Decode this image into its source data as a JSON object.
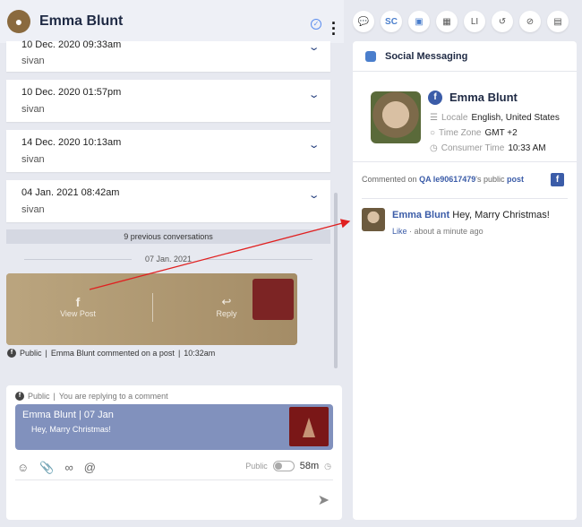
{
  "header": {
    "name": "Emma Blunt"
  },
  "conversations": [
    {
      "date": "10 Dec. 2020 09:33am",
      "user": "sivan"
    },
    {
      "date": "10 Dec. 2020 01:57pm",
      "user": "sivan"
    },
    {
      "date": "14 Dec. 2020 10:13am",
      "user": "sivan"
    },
    {
      "date": "04 Jan. 2021 08:42am",
      "user": "sivan"
    }
  ],
  "previous_conversations": "9 previous conversations",
  "date_separator": "07 Jan. 2021",
  "post_card": {
    "view_post": "View Post",
    "reply": "Reply"
  },
  "post_meta": {
    "visibility": "Public",
    "text": "Emma Blunt commented on a post",
    "time": "10:32am"
  },
  "composer": {
    "visibility": "Public",
    "context": "You are replying to a comment",
    "quote_title": "Emma Blunt | 07 Jan",
    "quote_message": "Hey, Marry Christmas!",
    "toggle_label": "Public",
    "timer": "58m"
  },
  "iconbar": [
    {
      "icon": "chat-bubble-icon",
      "label": ""
    },
    {
      "icon": "sc-icon",
      "label": "SC"
    },
    {
      "icon": "id-card-icon",
      "label": ""
    },
    {
      "icon": "building-icon",
      "label": ""
    },
    {
      "icon": "li-icon",
      "label": "LI"
    },
    {
      "icon": "history-icon",
      "label": ""
    },
    {
      "icon": "compass-icon",
      "label": ""
    },
    {
      "icon": "clipboard-icon",
      "label": ""
    }
  ],
  "panel": {
    "title": "Social Messaging",
    "profile": {
      "name": "Emma Blunt",
      "locale_label": "Locale",
      "locale_value": "English, United States",
      "timezone_label": "Time Zone",
      "timezone_value": "GMT +2",
      "consumer_time_label": "Consumer Time",
      "consumer_time_value": "10:33 AM"
    },
    "commented": {
      "prefix": "Commented on",
      "page": "QA le90617479",
      "middle": "'s public",
      "link": "post"
    },
    "comment": {
      "author": "Emma Blunt",
      "text": "Hey, Marry Christmas!",
      "like": "Like",
      "time": "about a minute ago"
    }
  },
  "colors": {
    "accent": "#3b5ca8",
    "quote_bg": "#8191bd",
    "arrow": "#e02020"
  }
}
